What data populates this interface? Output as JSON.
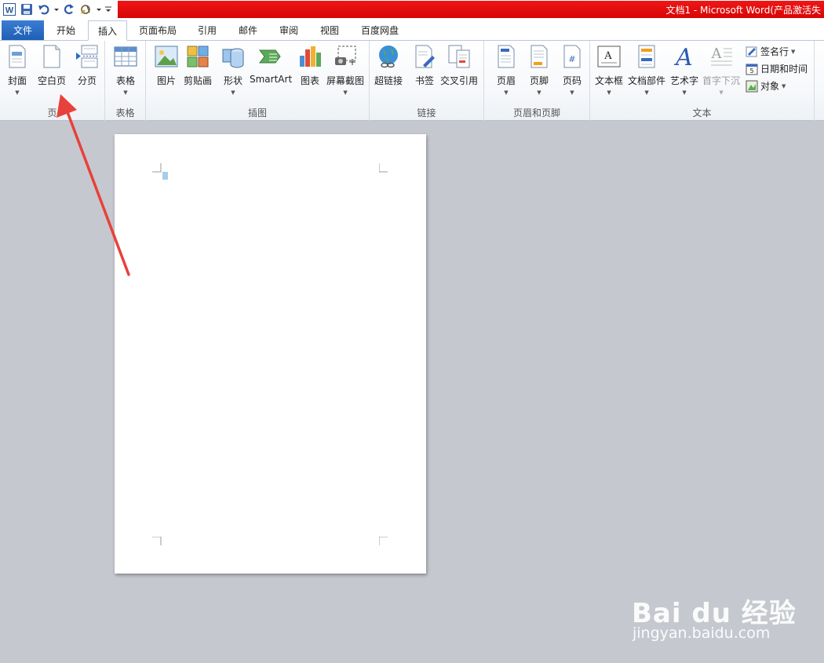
{
  "window": {
    "title": "文档1 - Microsoft Word(产品激活失",
    "app_icon_letter": "W"
  },
  "tabs": [
    {
      "label": "文件"
    },
    {
      "label": "开始"
    },
    {
      "label": "插入"
    },
    {
      "label": "页面布局"
    },
    {
      "label": "引用"
    },
    {
      "label": "邮件"
    },
    {
      "label": "审阅"
    },
    {
      "label": "视图"
    },
    {
      "label": "百度网盘"
    }
  ],
  "active_tab": "插入",
  "ribbon": {
    "groups": {
      "pages": {
        "label": "页",
        "buttons": [
          "封面",
          "空白页",
          "分页"
        ]
      },
      "tables": {
        "label": "表格",
        "buttons": [
          "表格"
        ]
      },
      "illustrations": {
        "label": "插图",
        "buttons": [
          "图片",
          "剪贴画",
          "形状",
          "SmartArt",
          "图表",
          "屏幕截图"
        ]
      },
      "links": {
        "label": "链接",
        "buttons": [
          "超链接",
          "书签",
          "交叉引用"
        ]
      },
      "header_footer": {
        "label": "页眉和页脚",
        "buttons": [
          "页眉",
          "页脚",
          "页码"
        ]
      },
      "text": {
        "label": "文本",
        "buttons": [
          "文本框",
          "文档部件",
          "艺术字",
          "首字下沉"
        ],
        "small_buttons": [
          "签名行",
          "日期和时间",
          "对象"
        ]
      }
    }
  },
  "watermark": {
    "brand": "Bai du 经验",
    "url": "jingyan.baidu.com"
  },
  "colors": {
    "title_bar": "#e01010",
    "file_tab": "#2a6cc4",
    "annotation_arrow": "#e8413c"
  }
}
